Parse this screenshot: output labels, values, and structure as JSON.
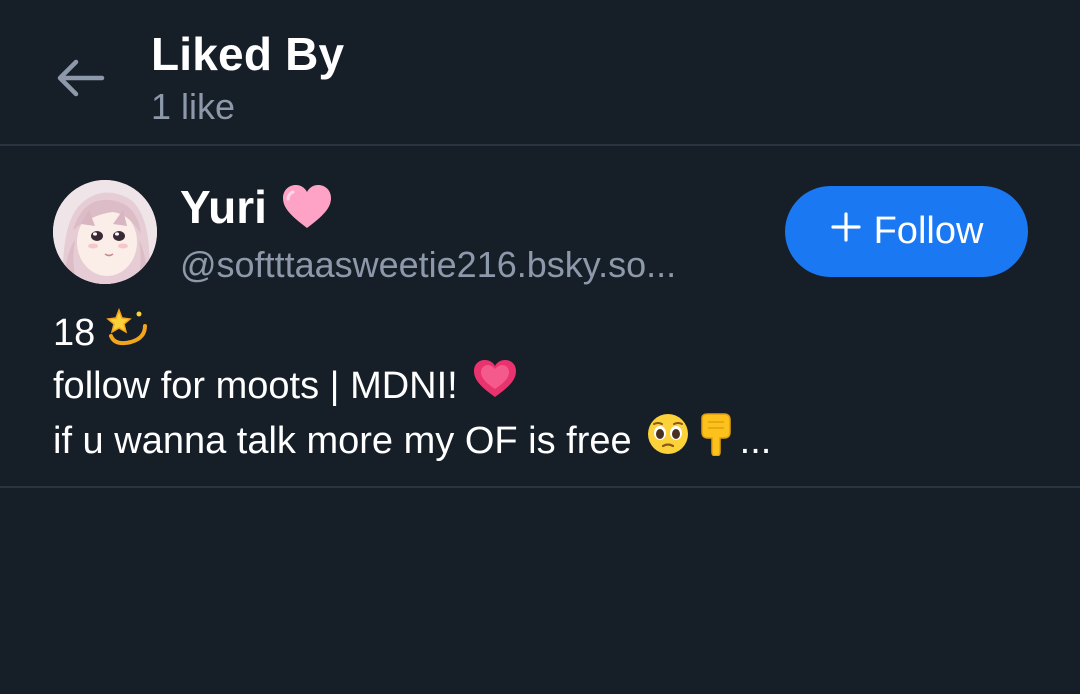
{
  "header": {
    "title": "Liked By",
    "subtitle": "1 like"
  },
  "users": [
    {
      "display_name": "Yuri",
      "name_emoji": "pink-heart",
      "handle": "@softttaasweetie216.bsky.so...",
      "follow_label": "Follow",
      "bio": {
        "line1": "18",
        "line1_emoji": "dizzy-star",
        "line2": "follow for moots | MDNI!",
        "line2_emoji": "growing-heart",
        "line3": "if u wanna talk more my OF is free",
        "line3_emojis": [
          "pleading-face",
          "pointing-down"
        ],
        "line3_suffix": "..."
      }
    }
  ],
  "colors": {
    "background": "#161e27",
    "divider": "#2a3440",
    "muted_text": "#8d99ab",
    "accent": "#1a78f2"
  }
}
